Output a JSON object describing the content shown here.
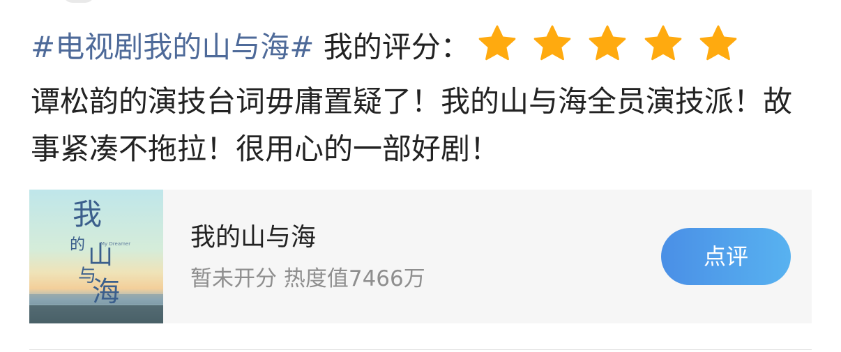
{
  "post": {
    "topic": "#电视剧我的山与海#",
    "rating_label": " 我的评分：",
    "rating": {
      "value": 5,
      "max": 5,
      "color": "#ffaa0f"
    },
    "body": "谭松韵的演技台词毋庸置疑了！我的山与海全员演技派！故事紧凑不拖拉！很用心的一部好剧！"
  },
  "card": {
    "poster_text": [
      "我",
      "的",
      "山",
      "与",
      "海"
    ],
    "poster_subtext": "My Dreamer",
    "title": "我的山与海",
    "meta": "暂未开分 热度值7466万",
    "button_label": "点评",
    "button_color": "#4a9be9"
  }
}
